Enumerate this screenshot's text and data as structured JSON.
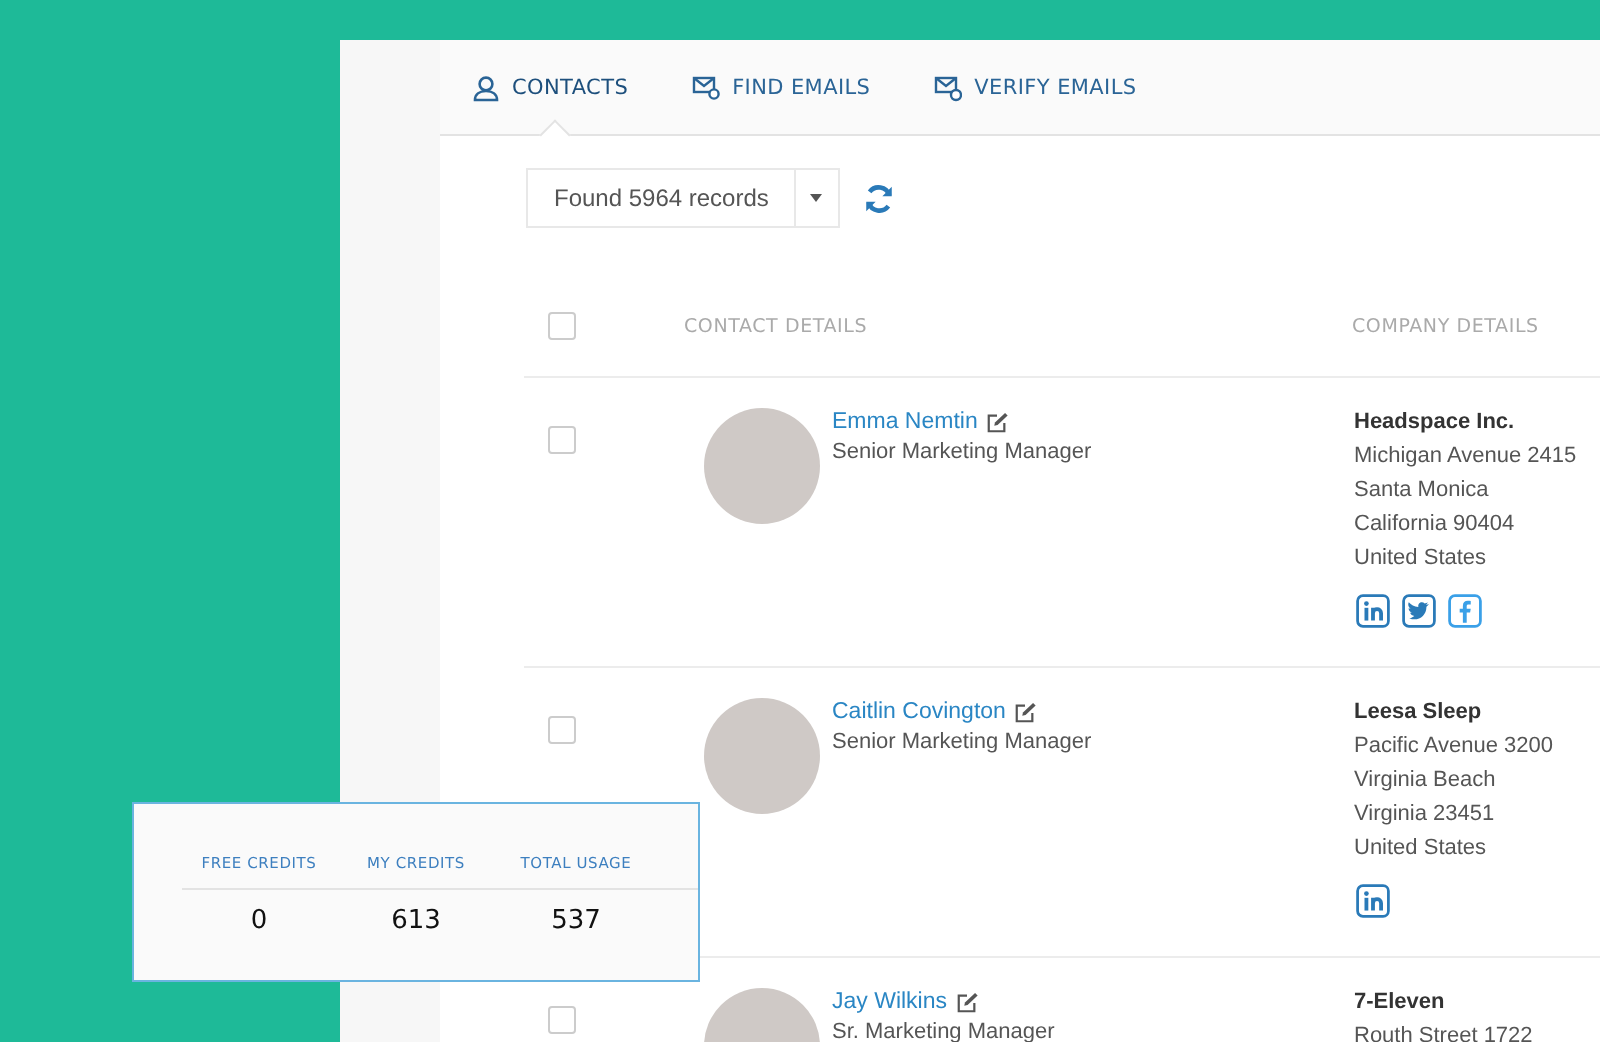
{
  "tabs": [
    {
      "label": "CONTACTS",
      "kind": "contacts",
      "selected": true
    },
    {
      "label": "FIND EMAILS",
      "kind": "find",
      "selected": false
    },
    {
      "label": "VERIFY EMAILS",
      "kind": "verify",
      "selected": false
    }
  ],
  "records": {
    "label": "Found 5964 records"
  },
  "table": {
    "select_all": {
      "checked": false
    },
    "columns": [
      "CONTACT DETAILS",
      "COMPANY DETAILS"
    ],
    "rows": [
      {
        "checked": false,
        "name": "Emma Nemtin",
        "title": "Senior Marketing Manager",
        "company": "Headspace Inc.",
        "address": [
          "Michigan Avenue 2415",
          "Santa Monica",
          "California 90404",
          "United States"
        ],
        "socials": [
          {
            "kind": "linkedin"
          },
          {
            "kind": "twitter"
          },
          {
            "kind": "facebook"
          }
        ]
      },
      {
        "checked": false,
        "name": "Caitlin Covington",
        "title": "Senior Marketing Manager",
        "company": "Leesa Sleep",
        "address": [
          "Pacific Avenue 3200",
          "Virginia Beach",
          "Virginia 23451",
          "United States"
        ],
        "socials": [
          {
            "kind": "linkedin"
          }
        ]
      },
      {
        "checked": false,
        "name": "Jay Wilkins",
        "title": "Sr. Marketing Manager",
        "company": "7-Eleven",
        "address": [
          "Routh Street 1722"
        ],
        "socials": []
      }
    ]
  },
  "credits": [
    {
      "label": "FREE CREDITS",
      "value": "0"
    },
    {
      "label": "MY CREDITS",
      "value": "613"
    },
    {
      "label": "TOTAL USAGE",
      "value": "537"
    }
  ]
}
